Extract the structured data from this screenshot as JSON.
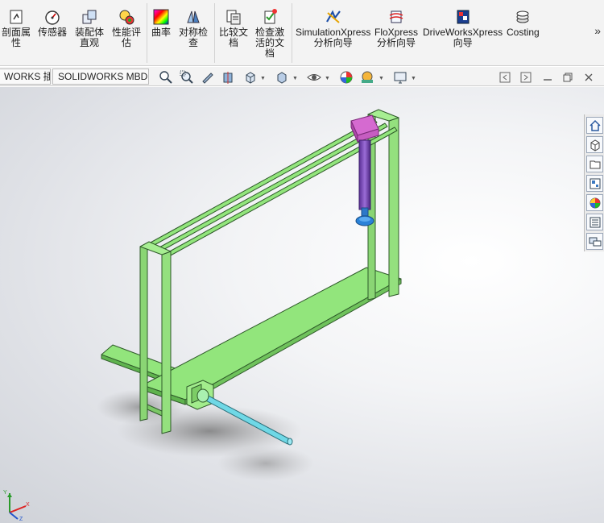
{
  "ribbon": {
    "buttons": [
      {
        "id": "section-properties",
        "label": "剖面属\n性",
        "icon": "section-properties-icon"
      },
      {
        "id": "sensors",
        "label": "传感器",
        "icon": "sensor-gauge-icon"
      },
      {
        "id": "assembly-visualization",
        "label": "装配体\n直观",
        "icon": "assembly-visualization-icon"
      },
      {
        "id": "performance-evaluation",
        "label": "性能评\n估",
        "icon": "performance-evaluation-icon"
      },
      {
        "id": "curvature",
        "label": "曲率",
        "icon": "curvature-icon"
      },
      {
        "id": "symmetry-check",
        "label": "对称检\n查",
        "icon": "symmetry-check-icon"
      },
      {
        "id": "compare-documents",
        "label": "比较文\n档",
        "icon": "compare-documents-icon"
      },
      {
        "id": "check-active-document",
        "label": "检查激\n活的文\n档",
        "icon": "check-active-document-icon"
      },
      {
        "id": "simulationxpress",
        "label": "SimulationXpress\n分析向导",
        "icon": "simulationxpress-icon"
      },
      {
        "id": "floxpress",
        "label": "FloXpress\n分析向导",
        "icon": "floxpress-icon"
      },
      {
        "id": "driveworksxpress",
        "label": "DriveWorksXpress\n向导",
        "icon": "driveworksxpress-icon"
      },
      {
        "id": "costing",
        "label": "Costing",
        "icon": "costing-icon"
      }
    ],
    "more": "»"
  },
  "tabs": [
    "WORKS 插件",
    "SOLIDWORKS MBD"
  ],
  "heads_up_toolbar": [
    "zoom-to-fit-icon",
    "zoom-to-area-icon",
    "previous-view-icon",
    "section-view-icon",
    "view-orientation-icon",
    "display-style-icon",
    "hide-show-items-icon",
    "edit-appearance-icon",
    "apply-scene-icon",
    "view-settings-icon"
  ],
  "window_controls": [
    "tile-left-icon",
    "tile-right-icon",
    "minimize-icon",
    "restore-icon",
    "close-icon"
  ],
  "task_pane": [
    "home-icon",
    "design-library-icon",
    "file-explorer-icon",
    "view-palette-icon",
    "appearances-icon",
    "custom-properties-icon",
    "forum-icon"
  ],
  "triad": {
    "x": "X",
    "y": "Y",
    "z": "Z"
  },
  "colors": {
    "frame_green": "#8ee07a",
    "frame_edge": "#2f5a2a",
    "cylinder": "#6c3aa8",
    "actuator_pink": "#d56ad0",
    "rod": "#6fd8e6",
    "accent_blue": "#0070c0"
  }
}
